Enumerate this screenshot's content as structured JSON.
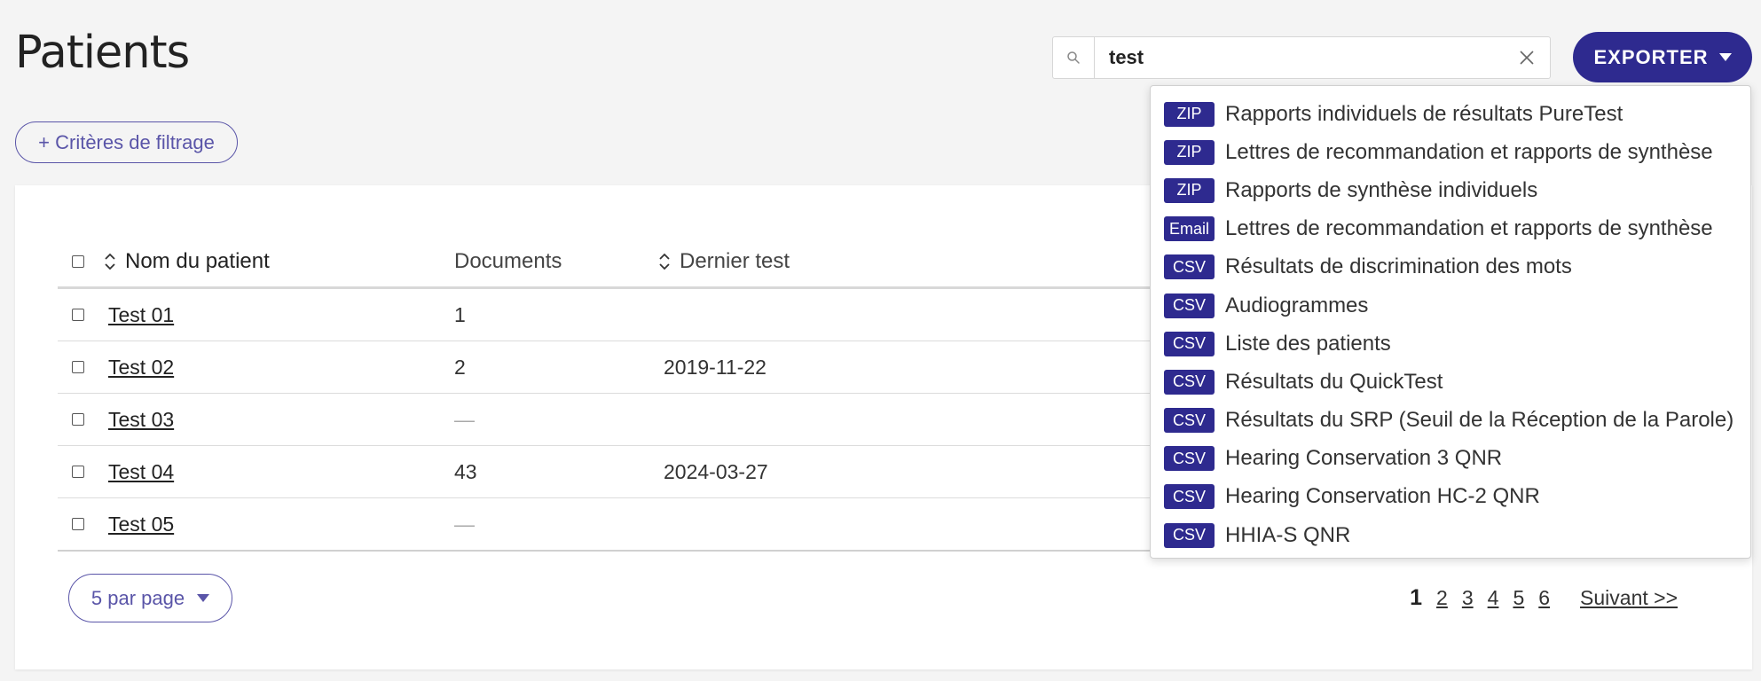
{
  "page": {
    "title": "Patients"
  },
  "search": {
    "value": "test",
    "placeholder": ""
  },
  "export_button": {
    "label": "EXPORTER"
  },
  "filter_button": {
    "label": "+ Critères de filtrage"
  },
  "table": {
    "columns": [
      "Nom du patient",
      "Documents",
      "Dernier test"
    ],
    "rows": [
      {
        "name": "Test 01",
        "documents": "1",
        "last_test": ""
      },
      {
        "name": "Test 02",
        "documents": "2",
        "last_test": "2019-11-22"
      },
      {
        "name": "Test 03",
        "documents": "—",
        "last_test": ""
      },
      {
        "name": "Test 04",
        "documents": "43",
        "last_test": "2024-03-27"
      },
      {
        "name": "Test 05",
        "documents": "—",
        "last_test": ""
      }
    ]
  },
  "per_page": {
    "label": "5 par page"
  },
  "pagination": {
    "pages": [
      "1",
      "2",
      "3",
      "4",
      "5",
      "6"
    ],
    "current": "1",
    "next_label": "Suivant >>"
  },
  "export_menu": [
    {
      "badge": "ZIP",
      "label": "Rapports individuels de résultats PureTest"
    },
    {
      "badge": "ZIP",
      "label": "Lettres de recommandation et rapports de synthèse"
    },
    {
      "badge": "ZIP",
      "label": "Rapports de synthèse individuels"
    },
    {
      "badge": "Email",
      "label": "Lettres de recommandation et rapports de synthèse"
    },
    {
      "badge": "CSV",
      "label": "Résultats de discrimination des mots"
    },
    {
      "badge": "CSV",
      "label": "Audiogrammes"
    },
    {
      "badge": "CSV",
      "label": "Liste des patients"
    },
    {
      "badge": "CSV",
      "label": "Résultats du QuickTest"
    },
    {
      "badge": "CSV",
      "label": "Résultats du SRP (Seuil de la Réception de la Parole)"
    },
    {
      "badge": "CSV",
      "label": "Hearing Conservation 3 QNR"
    },
    {
      "badge": "CSV",
      "label": "Hearing Conservation HC-2 QNR"
    },
    {
      "badge": "CSV",
      "label": "HHIA-S QNR"
    }
  ],
  "colors": {
    "accent": "#2e2a8f",
    "accent_outline": "#5a55a8",
    "background": "#f4f4f4"
  },
  "icons": {
    "search": "search-icon",
    "clear": "close-icon",
    "sort": "sort-icon",
    "caret": "caret-down-icon"
  }
}
